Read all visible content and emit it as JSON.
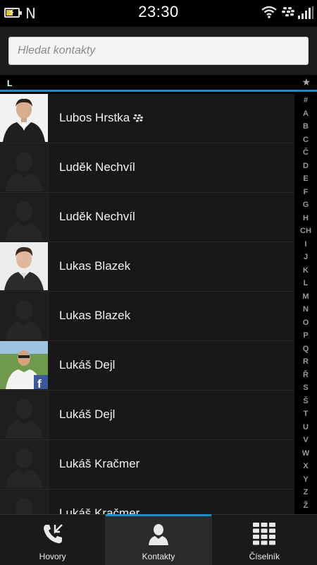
{
  "status_bar": {
    "time": "23:30",
    "nfc_glyph": "N",
    "icons": [
      "battery-charging-icon",
      "nfc-icon",
      "wifi-icon",
      "blackberry-messenger-icon",
      "signal-icon"
    ]
  },
  "search": {
    "placeholder": "Hledat kontakty"
  },
  "section": {
    "letter": "L",
    "star": "★"
  },
  "contacts": [
    {
      "name": "Lubos Hrstka",
      "photo": "man-suit",
      "bbm": true
    },
    {
      "name": "Luděk Nechvíl",
      "photo": "placeholder",
      "bbm": false
    },
    {
      "name": "Luděk Nechvíl",
      "photo": "placeholder",
      "bbm": false
    },
    {
      "name": "Lukas Blazek",
      "photo": "man-portrait",
      "bbm": false
    },
    {
      "name": "Lukas Blazek",
      "photo": "placeholder",
      "bbm": false
    },
    {
      "name": "Lukáš Dejl",
      "photo": "man-outdoor-facebook",
      "bbm": false
    },
    {
      "name": "Lukáš Dejl",
      "photo": "placeholder",
      "bbm": false
    },
    {
      "name": "Lukáš Kračmer",
      "photo": "placeholder",
      "bbm": false
    },
    {
      "name": "Lukáš Kračmer",
      "photo": "placeholder",
      "bbm": false
    }
  ],
  "alphabet_index": [
    "#",
    "A",
    "B",
    "C",
    "Č",
    "D",
    "E",
    "F",
    "G",
    "H",
    "CH",
    "I",
    "J",
    "K",
    "L",
    "M",
    "N",
    "O",
    "P",
    "Q",
    "R",
    "Ř",
    "S",
    "Š",
    "T",
    "U",
    "V",
    "W",
    "X",
    "Y",
    "Z",
    "Ž"
  ],
  "tabs": [
    {
      "label": "Hovory",
      "icon": "phone-calls-icon",
      "active": false
    },
    {
      "label": "Kontakty",
      "icon": "contact-person-icon",
      "active": true
    },
    {
      "label": "Číselník",
      "icon": "dialpad-icon",
      "active": false
    }
  ],
  "colors": {
    "accent": "#1b8fc4",
    "background": "#181818"
  }
}
